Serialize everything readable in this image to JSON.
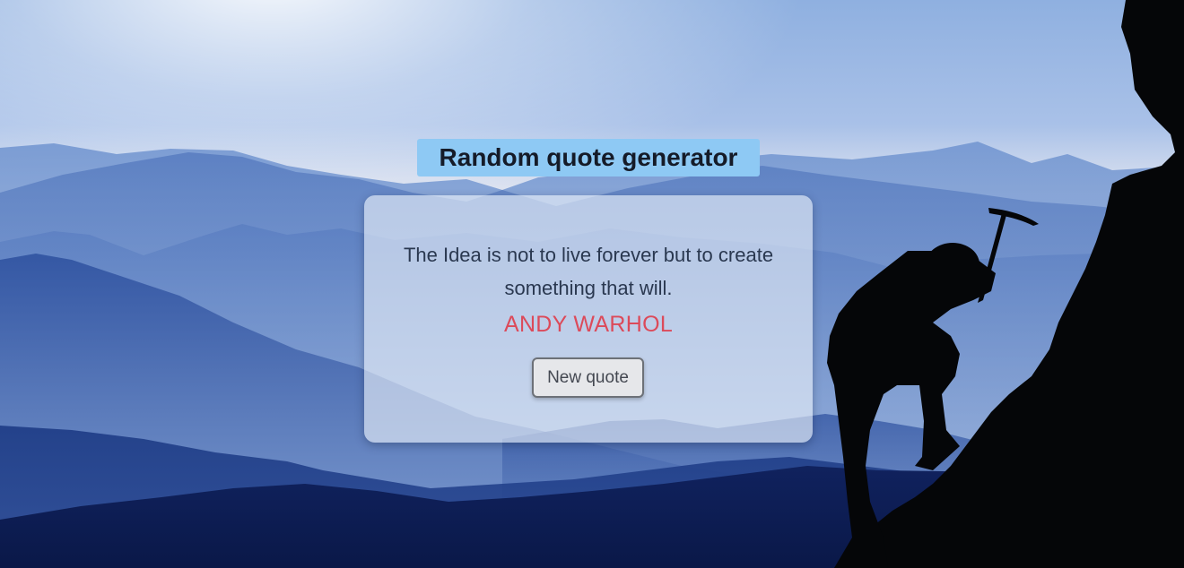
{
  "header": {
    "title": "Random quote generator"
  },
  "quote_card": {
    "quote_text": "The Idea is not to live forever but to create something that will.",
    "author": "ANDY WARHOL",
    "new_quote_button_label": "New quote"
  },
  "colors": {
    "title_background": "#8ec9f4",
    "author_color": "#dc4a5a",
    "quote_color": "#2a3850",
    "sky": "#9bb8e4",
    "silhouette": "#000000"
  },
  "icons": {
    "background": "mountain-climber-landscape"
  }
}
